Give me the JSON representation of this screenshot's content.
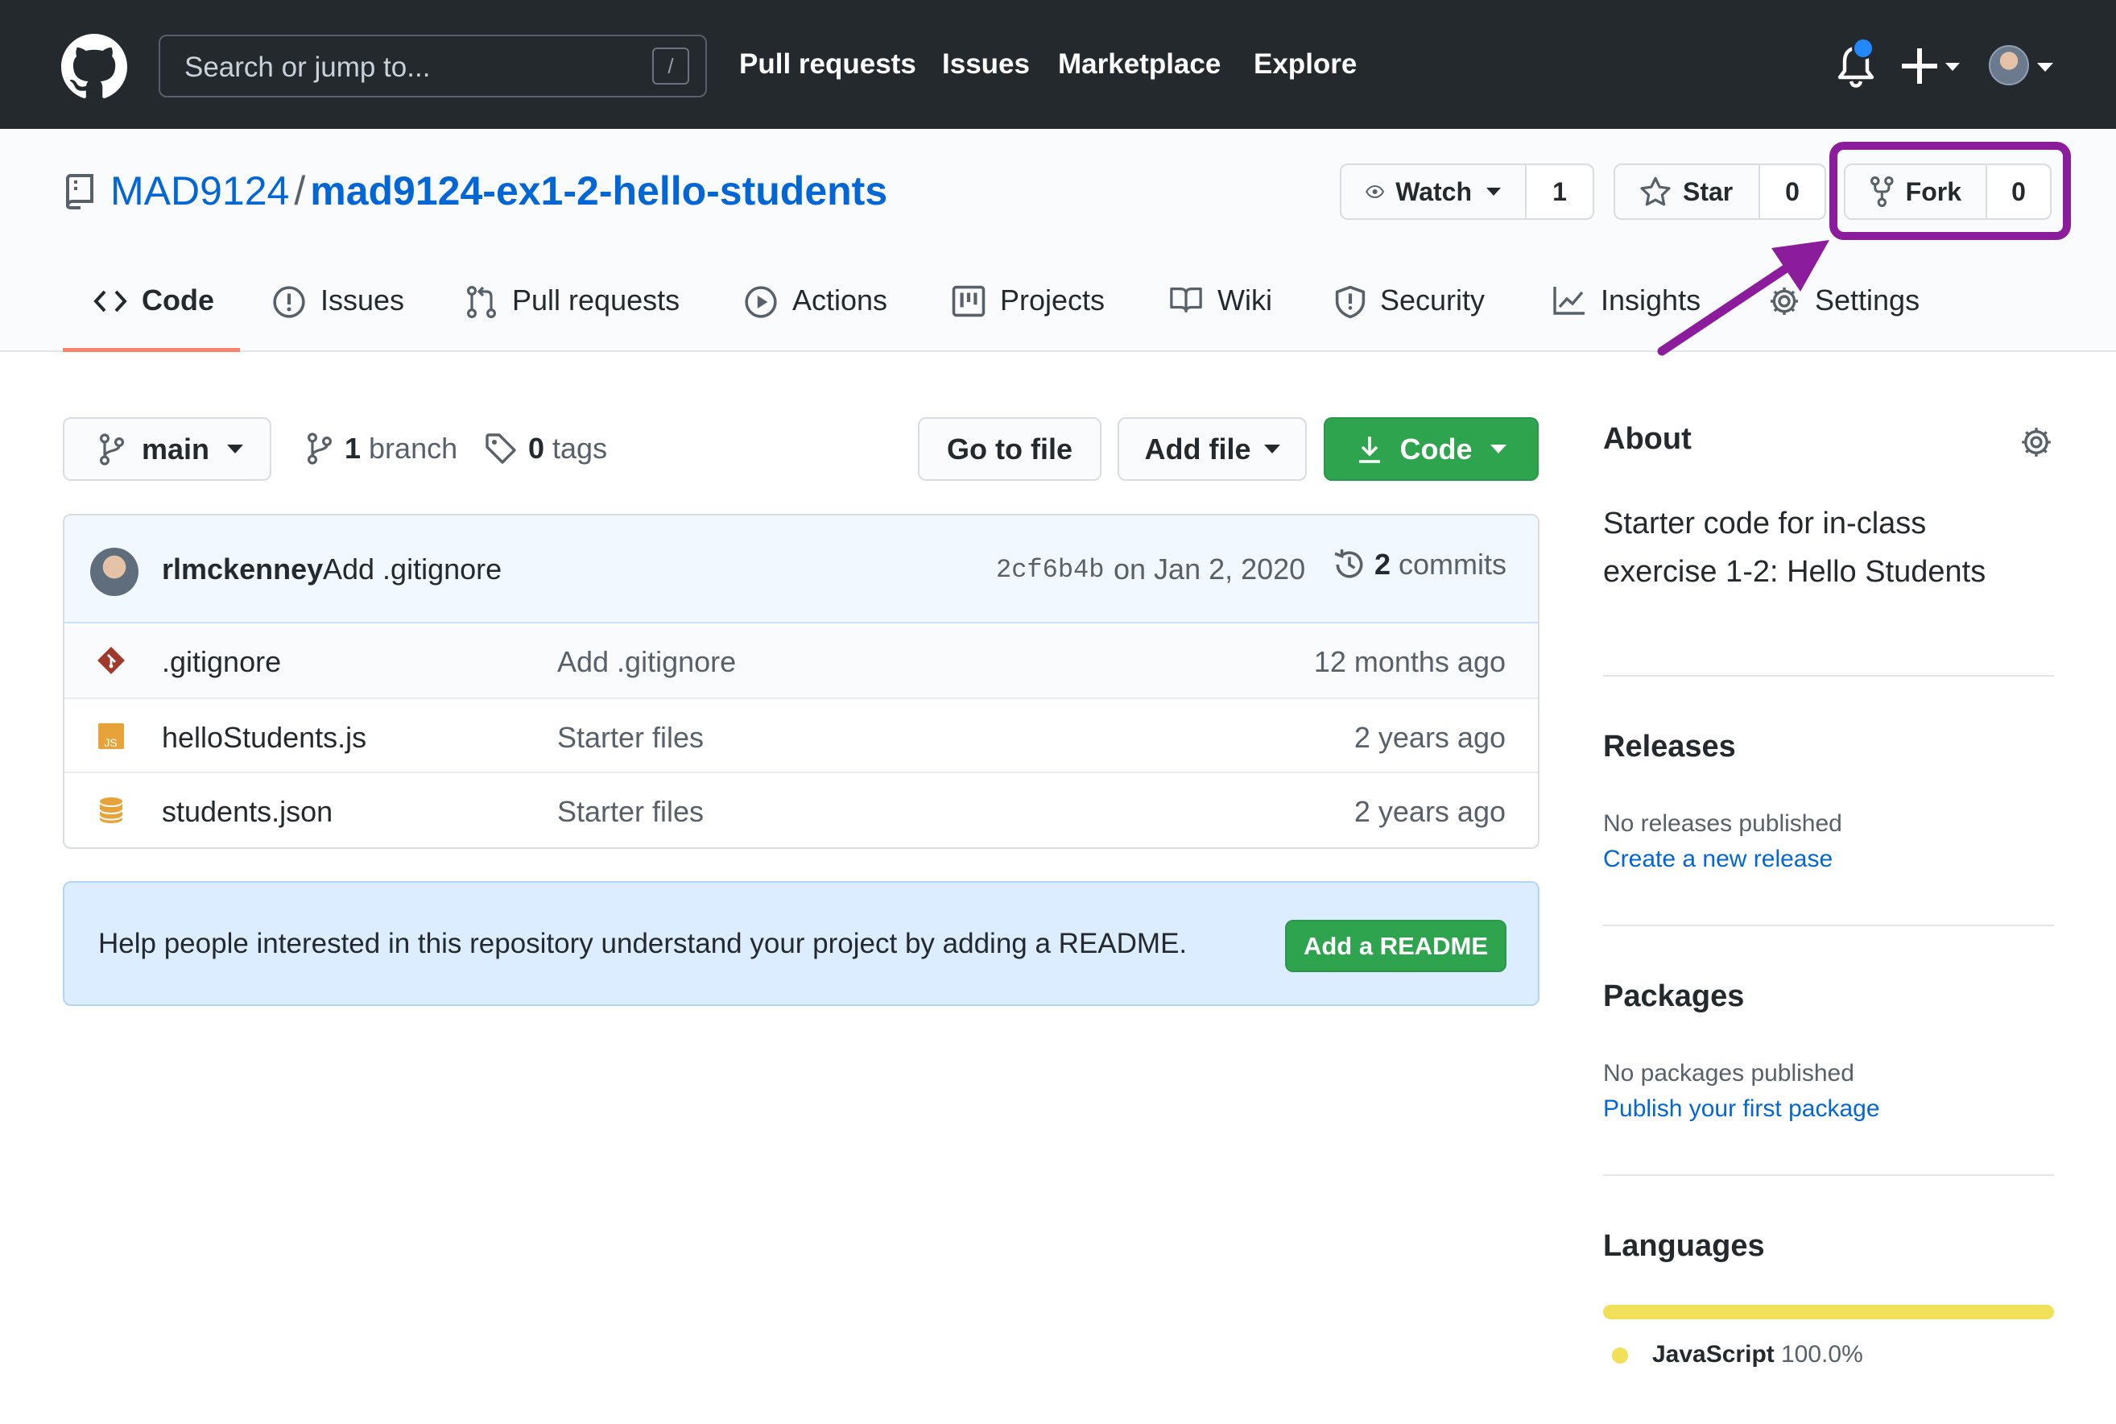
{
  "header": {
    "search_placeholder": "Search or jump to...",
    "search_shortcut": "/",
    "nav": [
      "Pull requests",
      "Issues",
      "Marketplace",
      "Explore"
    ]
  },
  "repo": {
    "owner": "MAD9124",
    "separator": "/",
    "name": "mad9124-ex1-2-hello-students",
    "watch_label": "Watch",
    "watch_count": "1",
    "star_label": "Star",
    "star_count": "0",
    "fork_label": "Fork",
    "fork_count": "0"
  },
  "tabs": [
    {
      "label": "Code",
      "icon": "code-icon"
    },
    {
      "label": "Issues",
      "icon": "issue-icon"
    },
    {
      "label": "Pull requests",
      "icon": "pull-request-icon"
    },
    {
      "label": "Actions",
      "icon": "play-icon"
    },
    {
      "label": "Projects",
      "icon": "project-icon"
    },
    {
      "label": "Wiki",
      "icon": "book-icon"
    },
    {
      "label": "Security",
      "icon": "shield-icon"
    },
    {
      "label": "Insights",
      "icon": "graph-icon"
    },
    {
      "label": "Settings",
      "icon": "gear-icon"
    }
  ],
  "toolbar": {
    "branch": "main",
    "branch_count": "1",
    "branch_label": "branch",
    "tag_count": "0",
    "tag_label": "tags",
    "go_to_file": "Go to file",
    "add_file": "Add file",
    "code": "Code"
  },
  "commit": {
    "author": "rlmckenney",
    "message": "Add .gitignore",
    "sha": "2cf6b4b",
    "date": "on Jan 2, 2020",
    "count": "2",
    "count_label": "commits"
  },
  "files": [
    {
      "name": ".gitignore",
      "message": "Add .gitignore",
      "age": "12 months ago",
      "icon": "git-file-icon"
    },
    {
      "name": "helloStudents.js",
      "message": "Starter files",
      "age": "2 years ago",
      "icon": "js-file-icon"
    },
    {
      "name": "students.json",
      "message": "Starter files",
      "age": "2 years ago",
      "icon": "json-file-icon"
    }
  ],
  "readme": {
    "text": "Help people interested in this repository understand your project by adding a README.",
    "button": "Add a README"
  },
  "sidebar": {
    "about_title": "About",
    "about_text": "Starter code for in-class exercise 1-2: Hello Students",
    "releases_title": "Releases",
    "releases_empty": "No releases published",
    "releases_link": "Create a new release",
    "packages_title": "Packages",
    "packages_empty": "No packages published",
    "packages_link": "Publish your first package",
    "languages_title": "Languages",
    "language_name": "JavaScript",
    "language_pct": "100.0%",
    "language_color": "#f1e05a",
    "language_share": 1.0
  },
  "colors": {
    "header_bg": "#24292e",
    "link": "#0366d6",
    "primary_button": "#2ea44f",
    "tab_underline": "#f9826c",
    "annotation": "#8b1d9c"
  }
}
